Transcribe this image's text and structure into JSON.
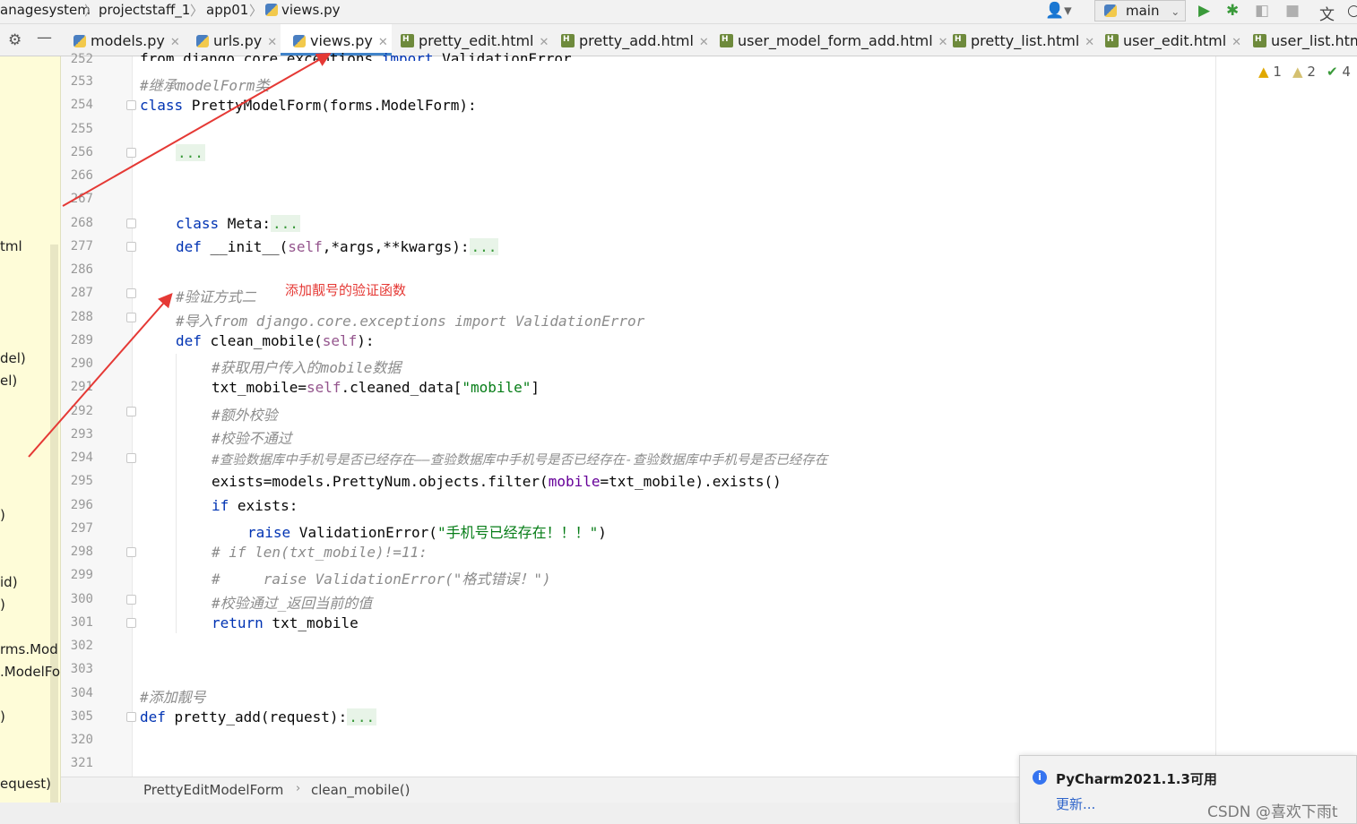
{
  "breadcrumb": {
    "items": [
      "anagesystem",
      "projectstaff_1",
      "app01",
      "views.py"
    ]
  },
  "toolbar": {
    "branch": "main"
  },
  "tabs": [
    {
      "label": "models.py",
      "icon": "python-file-icon",
      "active": false
    },
    {
      "label": "urls.py",
      "icon": "python-file-icon",
      "active": false
    },
    {
      "label": "views.py",
      "icon": "python-file-icon",
      "active": true
    },
    {
      "label": "pretty_edit.html",
      "icon": "html-file-icon",
      "active": false
    },
    {
      "label": "pretty_add.html",
      "icon": "html-file-icon",
      "active": false
    },
    {
      "label": "user_model_form_add.html",
      "icon": "html-file-icon",
      "active": false
    },
    {
      "label": "pretty_list.html",
      "icon": "html-file-icon",
      "active": false
    },
    {
      "label": "user_edit.html",
      "icon": "html-file-icon",
      "active": false
    },
    {
      "label": "user_list.htm",
      "icon": "html-file-icon",
      "active": false
    }
  ],
  "left_panel": {
    "items": [
      "tml",
      "del)",
      "el)",
      ")",
      "id)",
      ")",
      "rms.Mod",
      ".ModelFo",
      ")",
      "equest)"
    ]
  },
  "inspections": {
    "warnings": "1",
    "weak_warnings": "2",
    "ok": "4"
  },
  "line_numbers": [
    "252",
    "253",
    "254",
    "255",
    "256",
    "266",
    "267",
    "268",
    "277",
    "286",
    "287",
    "288",
    "289",
    "290",
    "291",
    "292",
    "293",
    "294",
    "295",
    "296",
    "297",
    "298",
    "299",
    "300",
    "301",
    "302",
    "303",
    "304",
    "305",
    "320",
    "321"
  ],
  "code": {
    "l252a": "from django.core.exceptions ",
    "l252b": "import",
    "l252c": " ValidationError",
    "l253": "#继承modelForm类",
    "l254_kw": "class",
    "l254_rest": " PrettyModelForm(forms.ModelForm):",
    "l256_dots": "...",
    "l268_kw": "class",
    "l268_rest": " Meta:",
    "l268_dots": "...",
    "l277_kw": "def",
    "l277_name": " __init__(",
    "l277_self": "self",
    "l277_rest": ",*args,**kwargs):",
    "l277_dots": "...",
    "l287": "#验证方式二",
    "l288": "#导入from django.core.exceptions import ValidationError",
    "l289_kw": "def",
    "l289_name": " clean_mobile(",
    "l289_self": "self",
    "l289_rest": "):",
    "l290": "#获取用户传入的mobile数据",
    "l291_a": "txt_mobile=",
    "l291_self": "self",
    "l291_b": ".cleaned_data[",
    "l291_str": "\"mobile\"",
    "l291_c": "]",
    "l292": "#额外校验",
    "l293": "#校验不通过",
    "l294": "#查验数据库中手机号是否已经存在——查验数据库中手机号是否已经存在-查验数据库中手机号是否已经存在",
    "l295_a": "exists=models.PrettyNum.objects.filter(",
    "l295_kwarg": "mobile",
    "l295_b": "=txt_mobile).exists()",
    "l296_kw": "if",
    "l296_rest": " exists:",
    "l297_kw": "raise",
    "l297_a": " ValidationError(",
    "l297_str": "\"手机号已经存在！！！\"",
    "l297_b": ")",
    "l298": "# if len(txt_mobile)!=11:",
    "l299": "#     raise ValidationError(\"格式错误！\")",
    "l300": "#校验通过_返回当前的值",
    "l301_kw": "return",
    "l301_rest": " txt_mobile",
    "l304": "#添加靓号",
    "l305_kw": "def",
    "l305_rest": " pretty_add(request):",
    "l305_dots": "..."
  },
  "annotation": {
    "text": "添加靓号的验证函数",
    "color": "#e53935"
  },
  "status_crumbs": {
    "class_name": "PrettyEditModelForm",
    "method": "clean_mobile()"
  },
  "notification": {
    "title": "PyCharm2021.1.3可用",
    "link": "更新..."
  },
  "watermark": "CSDN @喜欢下雨t"
}
